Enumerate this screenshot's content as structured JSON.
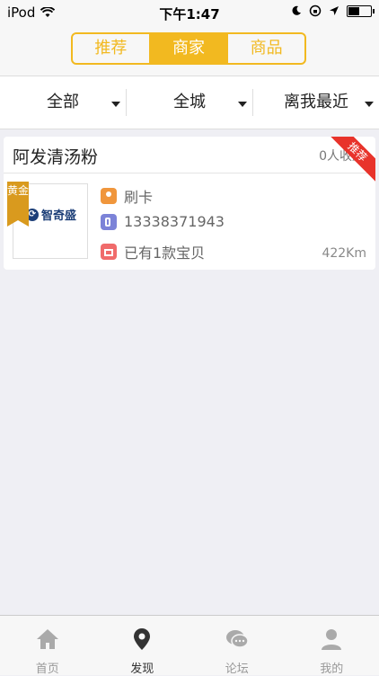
{
  "status": {
    "device": "iPod",
    "time": "下午1:47",
    "battery_level": 0.45
  },
  "segments": {
    "items": [
      "推荐",
      "商家",
      "商品"
    ],
    "active_index": 1
  },
  "filters": [
    {
      "label": "全部"
    },
    {
      "label": "全城"
    },
    {
      "label": "离我最近"
    }
  ],
  "merchant": {
    "name": "阿发清汤粉",
    "favorites": "0人收藏",
    "badge": "黄金",
    "logo_text": "智奇盛",
    "payment": "刷卡",
    "phone": "13338371943",
    "items": "已有1款宝贝",
    "distance": "422Km",
    "ribbon": "推荐"
  },
  "tabbar": {
    "items": [
      "首页",
      "发现",
      "论坛",
      "我的"
    ],
    "active_index": 1
  },
  "colors": {
    "accent": "#f2b920",
    "ribbon": "#e8332b",
    "gold_badge": "#d99a1e"
  }
}
